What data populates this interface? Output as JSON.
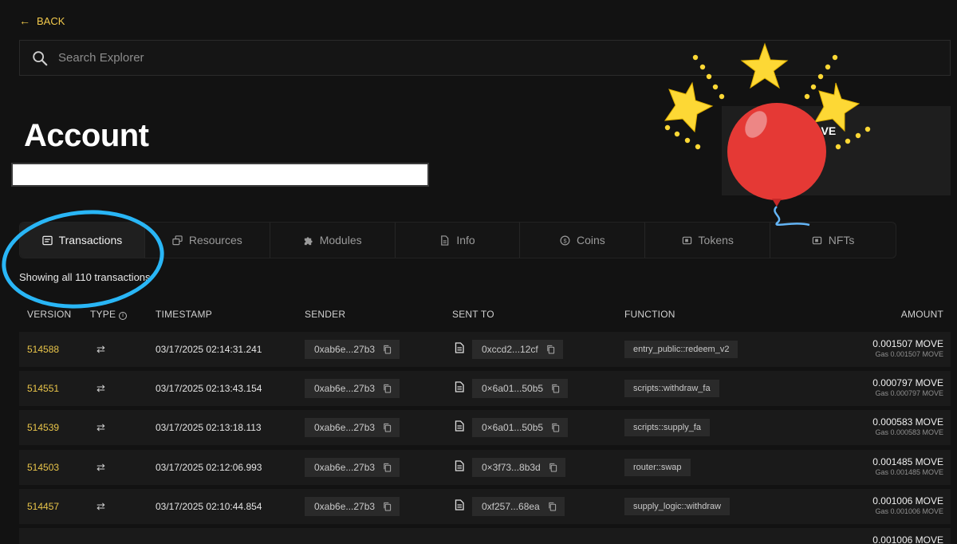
{
  "nav": {
    "back_label": "BACK"
  },
  "search": {
    "placeholder": "Search Explorer"
  },
  "page": {
    "title": "Account"
  },
  "balance": {
    "currency": "MOVE"
  },
  "tabs": [
    {
      "label": "Transactions",
      "icon": "list-icon"
    },
    {
      "label": "Resources",
      "icon": "resources-icon"
    },
    {
      "label": "Modules",
      "icon": "puzzle-icon"
    },
    {
      "label": "Info",
      "icon": "document-icon"
    },
    {
      "label": "Coins",
      "icon": "coin-icon"
    },
    {
      "label": "Tokens",
      "icon": "token-icon"
    },
    {
      "label": "NFTs",
      "icon": "nft-icon"
    }
  ],
  "summary": {
    "text": "Showing all 110 transactions"
  },
  "table": {
    "headers": {
      "version": "VERSION",
      "type": "TYPE",
      "timestamp": "TIMESTAMP",
      "sender": "SENDER",
      "sent_to": "SENT TO",
      "function": "FUNCTION",
      "amount": "AMOUNT"
    },
    "rows": [
      {
        "version": "514588",
        "timestamp": "03/17/2025 02:14:31.241",
        "sender": "0xab6e...27b3",
        "sent_to": "0xccd2...12cf",
        "function": "entry_public::redeem_v2",
        "amount": "0.001507 MOVE",
        "gas": "Gas 0.001507 MOVE"
      },
      {
        "version": "514551",
        "timestamp": "03/17/2025 02:13:43.154",
        "sender": "0xab6e...27b3",
        "sent_to": "0×6a01...50b5",
        "function": "scripts::withdraw_fa",
        "amount": "0.000797 MOVE",
        "gas": "Gas 0.000797 MOVE"
      },
      {
        "version": "514539",
        "timestamp": "03/17/2025 02:13:18.113",
        "sender": "0xab6e...27b3",
        "sent_to": "0×6a01...50b5",
        "function": "scripts::supply_fa",
        "amount": "0.000583 MOVE",
        "gas": "Gas 0.000583 MOVE"
      },
      {
        "version": "514503",
        "timestamp": "03/17/2025 02:12:06.993",
        "sender": "0xab6e...27b3",
        "sent_to": "0×3f73...8b3d",
        "function": "router::swap",
        "amount": "0.001485 MOVE",
        "gas": "Gas 0.001485 MOVE"
      },
      {
        "version": "514457",
        "timestamp": "03/17/2025 02:10:44.854",
        "sender": "0xab6e...27b3",
        "sent_to": "0xf257...68ea",
        "function": "supply_logic::withdraw",
        "amount": "0.001006 MOVE",
        "gas": "Gas 0.001006 MOVE"
      },
      {
        "version": "",
        "timestamp": "",
        "sender": "",
        "sent_to": "",
        "function": "",
        "amount": "0.001006 MOVE",
        "gas": ""
      }
    ]
  },
  "colors": {
    "accent": "#e9c54a",
    "annotation": "#29b6f6",
    "balloon": "#e53935",
    "star": "#fdd835"
  }
}
